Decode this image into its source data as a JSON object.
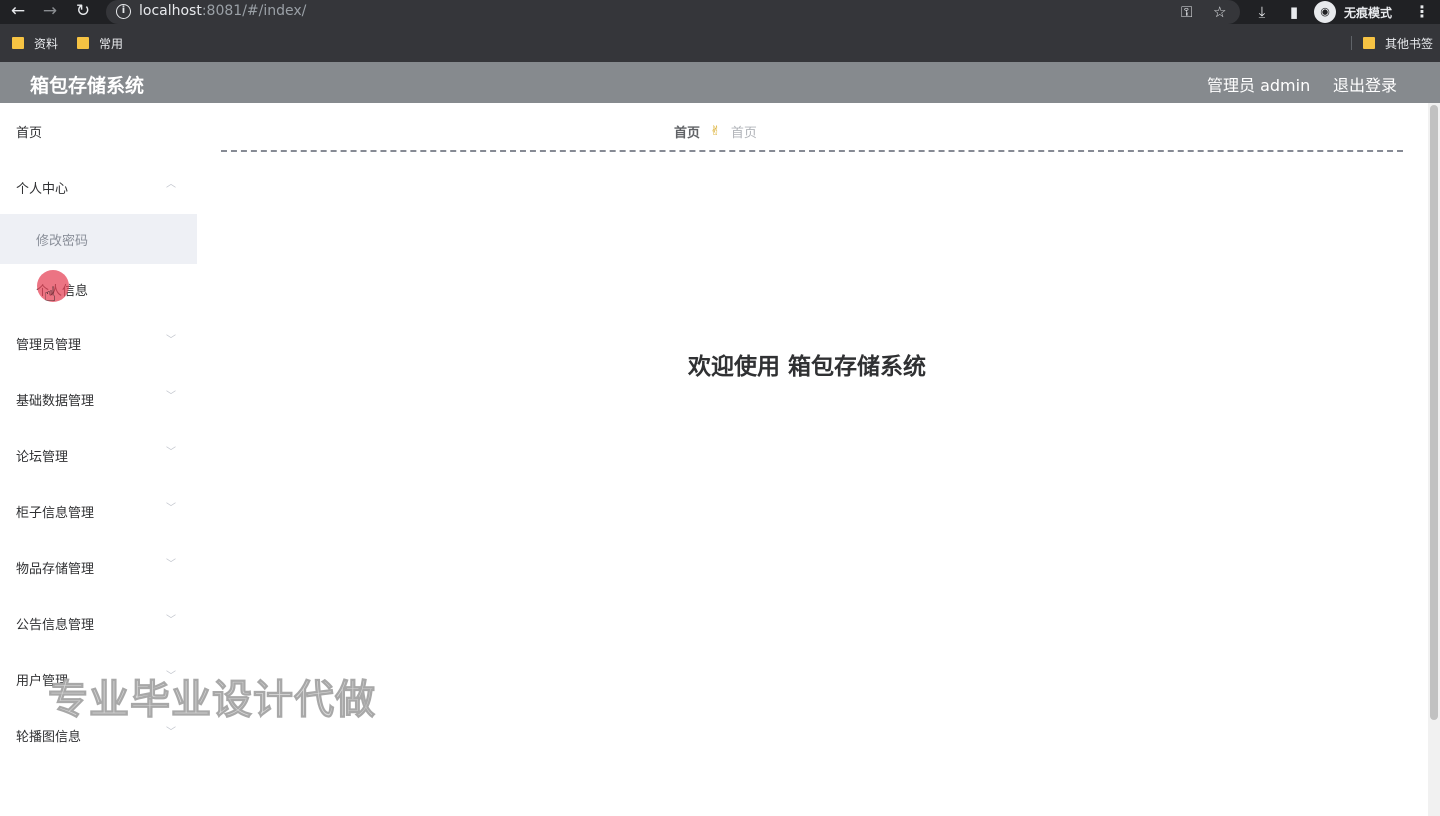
{
  "browser": {
    "url_host": "localhost",
    "url_rest": ":8081/#/index/",
    "incognito_label": "无痕模式",
    "bookmarks": [
      "资料",
      "常用"
    ],
    "other_bookmarks": "其他书签",
    "icons": {
      "back": "←",
      "forward": "→",
      "reload": "↻",
      "info": "i",
      "key": "⚿",
      "star": "☆",
      "download": "⤓",
      "sidepanel": "▮",
      "incognito": "◉",
      "menu": "⋮"
    }
  },
  "header": {
    "title": "箱包存储系统",
    "user": "管理员 admin",
    "logout": "退出登录"
  },
  "sidebar": {
    "items": [
      {
        "label": "首页",
        "arrow": ""
      },
      {
        "label": "个人中心",
        "arrow": "︿"
      },
      {
        "label": "管理员管理",
        "arrow": "﹀"
      },
      {
        "label": "基础数据管理",
        "arrow": "﹀"
      },
      {
        "label": "论坛管理",
        "arrow": "﹀"
      },
      {
        "label": "柜子信息管理",
        "arrow": "﹀"
      },
      {
        "label": "物品存储管理",
        "arrow": "﹀"
      },
      {
        "label": "公告信息管理",
        "arrow": "﹀"
      },
      {
        "label": "用户管理",
        "arrow": "﹀"
      },
      {
        "label": "轮播图信息",
        "arrow": "﹀"
      }
    ],
    "sub_items": [
      "修改密码",
      "个人信息"
    ]
  },
  "breadcrumb": {
    "home": "首页",
    "icon": "✌",
    "current": "首页"
  },
  "main": {
    "welcome": "欢迎使用 箱包存储系统"
  },
  "watermark": "专业毕业设计代做",
  "cursor": {
    "icon": "☝"
  }
}
